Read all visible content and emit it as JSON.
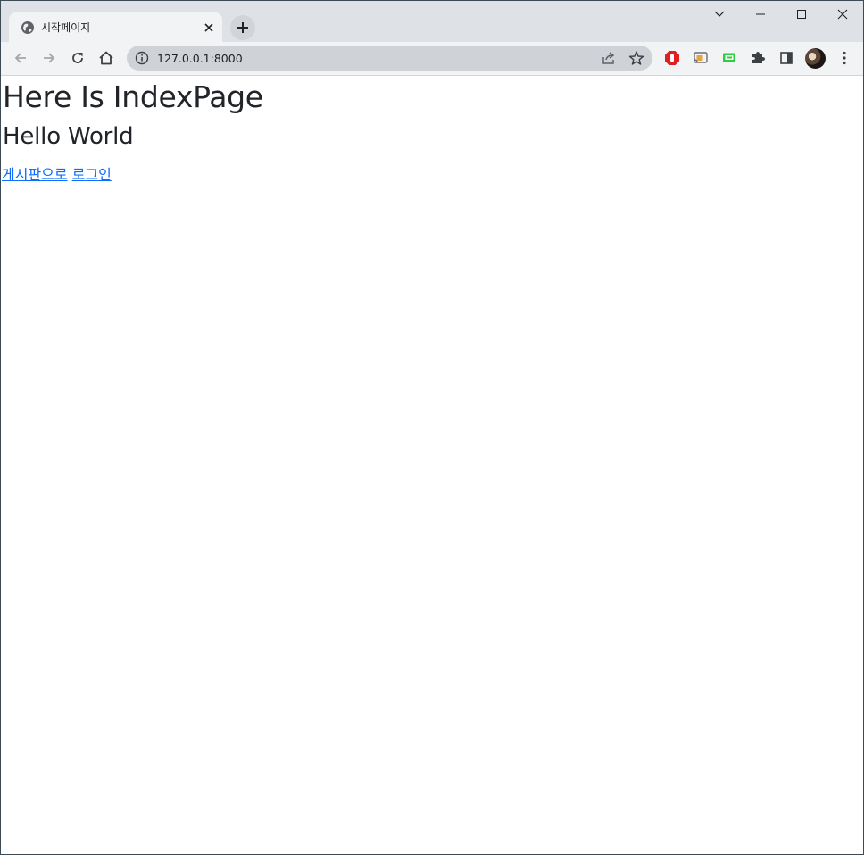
{
  "browser": {
    "tab": {
      "title": "시작페이지",
      "favicon": "globe-icon",
      "close": "close-icon"
    },
    "new_tab": "plus-icon",
    "window_controls": [
      "tab-search-chevron-icon",
      "minimize-icon",
      "maximize-icon",
      "close-icon"
    ],
    "address_bar": {
      "url": "127.0.0.1:8000",
      "info_icon": "info-icon"
    },
    "extensions": [
      "adblock-icon",
      "cast-icon",
      "screen-icon",
      "puzzle-icon",
      "side-panel-icon"
    ],
    "colors": {
      "tabstrip": "#dee1e6",
      "toolbar": "#f1f3f4",
      "omnibox": "#cfd2d6",
      "link": "#0d6efd",
      "text": "#212529"
    }
  },
  "page": {
    "heading": "Here Is IndexPage",
    "subheading": "Hello World",
    "links": [
      {
        "label": "게시판으로"
      },
      {
        "label": "로그인"
      }
    ]
  }
}
